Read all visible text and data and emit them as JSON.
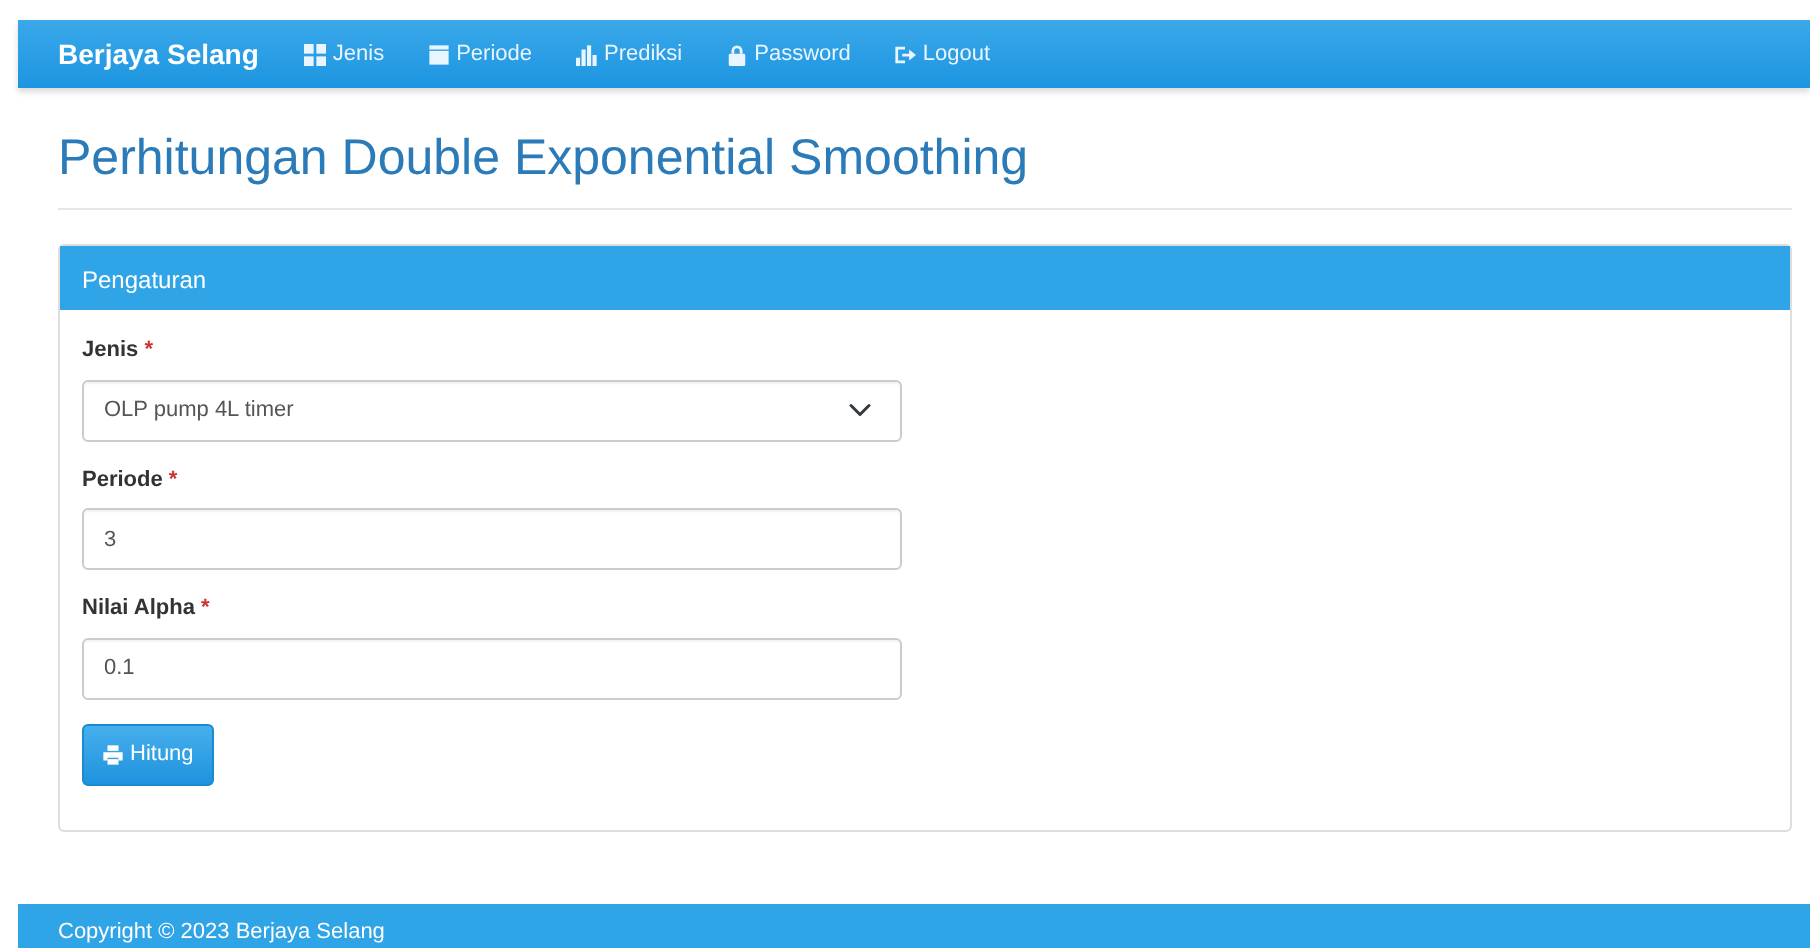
{
  "navbar": {
    "brand": "Berjaya Selang",
    "items": [
      {
        "label": "Jenis"
      },
      {
        "label": "Periode"
      },
      {
        "label": "Prediksi"
      },
      {
        "label": "Password"
      },
      {
        "label": "Logout"
      }
    ]
  },
  "title": "Perhitungan Double Exponential Smoothing",
  "panel": {
    "heading": "Pengaturan",
    "fields": [
      {
        "kind": "select",
        "label": "Jenis",
        "required_mark": "*",
        "value": "OLP pump 4L timer"
      },
      {
        "kind": "input",
        "label": "Periode",
        "required_mark": "*",
        "value": "3"
      },
      {
        "kind": "input",
        "label": "Nilai Alpha",
        "required_mark": "*",
        "value": "0.1"
      }
    ],
    "button": {
      "label": "Hitung"
    }
  },
  "footer": "Copyright © 2023 Berjaya Selang"
}
